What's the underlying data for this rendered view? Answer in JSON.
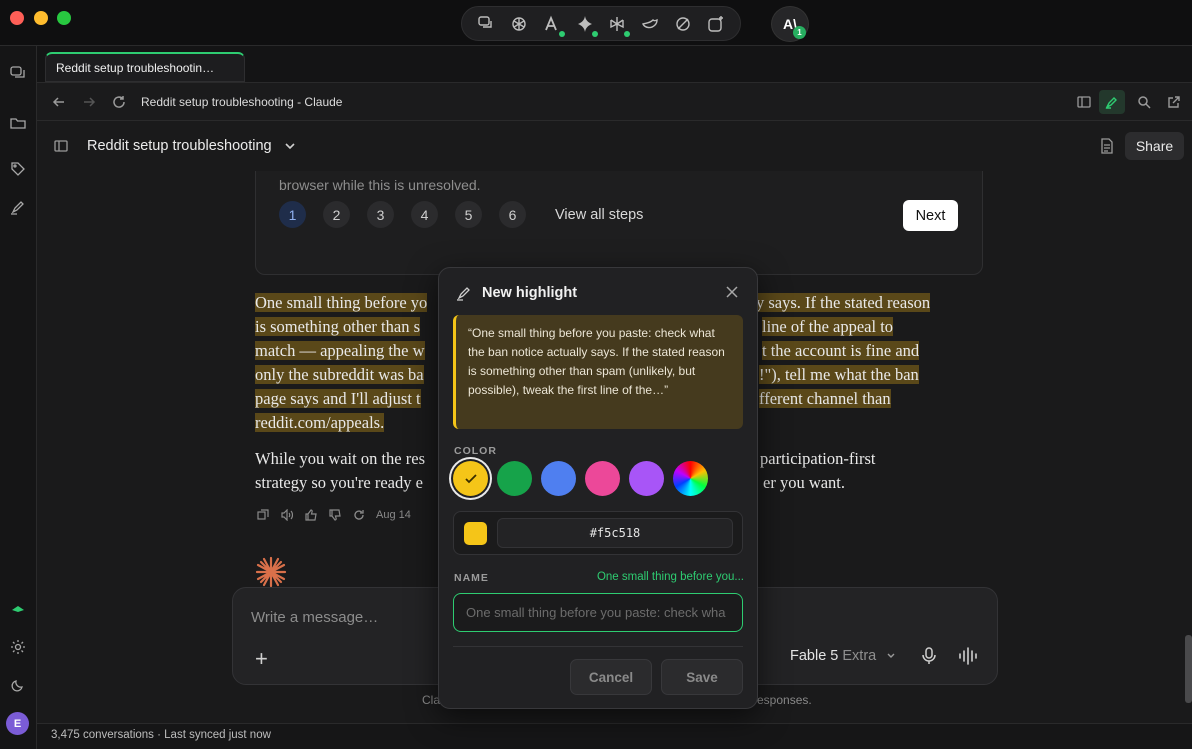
{
  "tab": {
    "title": "Reddit setup troubleshootin…"
  },
  "navbar": {
    "page_title": "Reddit setup troubleshooting - Claude"
  },
  "conversation": {
    "title": "Reddit setup troubleshooting",
    "share_label": "Share"
  },
  "steps_card": {
    "preview_text": "browser while this is unresolved.",
    "steps": [
      "1",
      "2",
      "3",
      "4",
      "5",
      "6"
    ],
    "active_step": "1",
    "view_all_label": "View all steps",
    "next_label": "Next"
  },
  "message": {
    "para1_lines": [
      "One small thing before yo",
      "is something other than s",
      "match — appealing the w",
      "only the subreddit was ba",
      "page says and I'll adjust t",
      "reddit.com/appeals."
    ],
    "para1_right_lines": [
      "y says. If the stated reason",
      "line of the appeal to",
      "t the account is fine and",
      "!\"), tell me what the ban",
      "fferent channel than"
    ],
    "para2_left": [
      "While you wait on the res",
      "strategy so you're ready e"
    ],
    "para2_right": [
      "participation-first",
      "er you want."
    ],
    "date": "Aug 14"
  },
  "composer": {
    "placeholder": "Write a message…",
    "model_name": "Fable 5",
    "model_mode": "Extra"
  },
  "disclaimer": {
    "left": "Cla",
    "right": "esponses."
  },
  "statusbar": {
    "text": "3,475 conversations · Last synced just now"
  },
  "avatar": {
    "top_initials": "A\\",
    "badge": "1",
    "user_initial": "E"
  },
  "highlight_modal": {
    "title": "New highlight",
    "quote": "“One small thing before you paste: check what the ban notice actually says. If the stated reason is something other than spam (unlikely, but possible), tweak the first line of the…”",
    "color_label": "COLOR",
    "colors": [
      "#f5c518",
      "#16a34a",
      "#4f7ff0",
      "#ec4899",
      "#a855f7"
    ],
    "selected_color": "#f5c518",
    "hex_value": "#f5c518",
    "name_label": "NAME",
    "name_hint": "One small thing before you...",
    "name_placeholder": "One small thing before you paste: check wha",
    "cancel_label": "Cancel",
    "save_label": "Save"
  },
  "colors": {
    "accent": "#2ecc71",
    "highlight": "#f5c518"
  }
}
